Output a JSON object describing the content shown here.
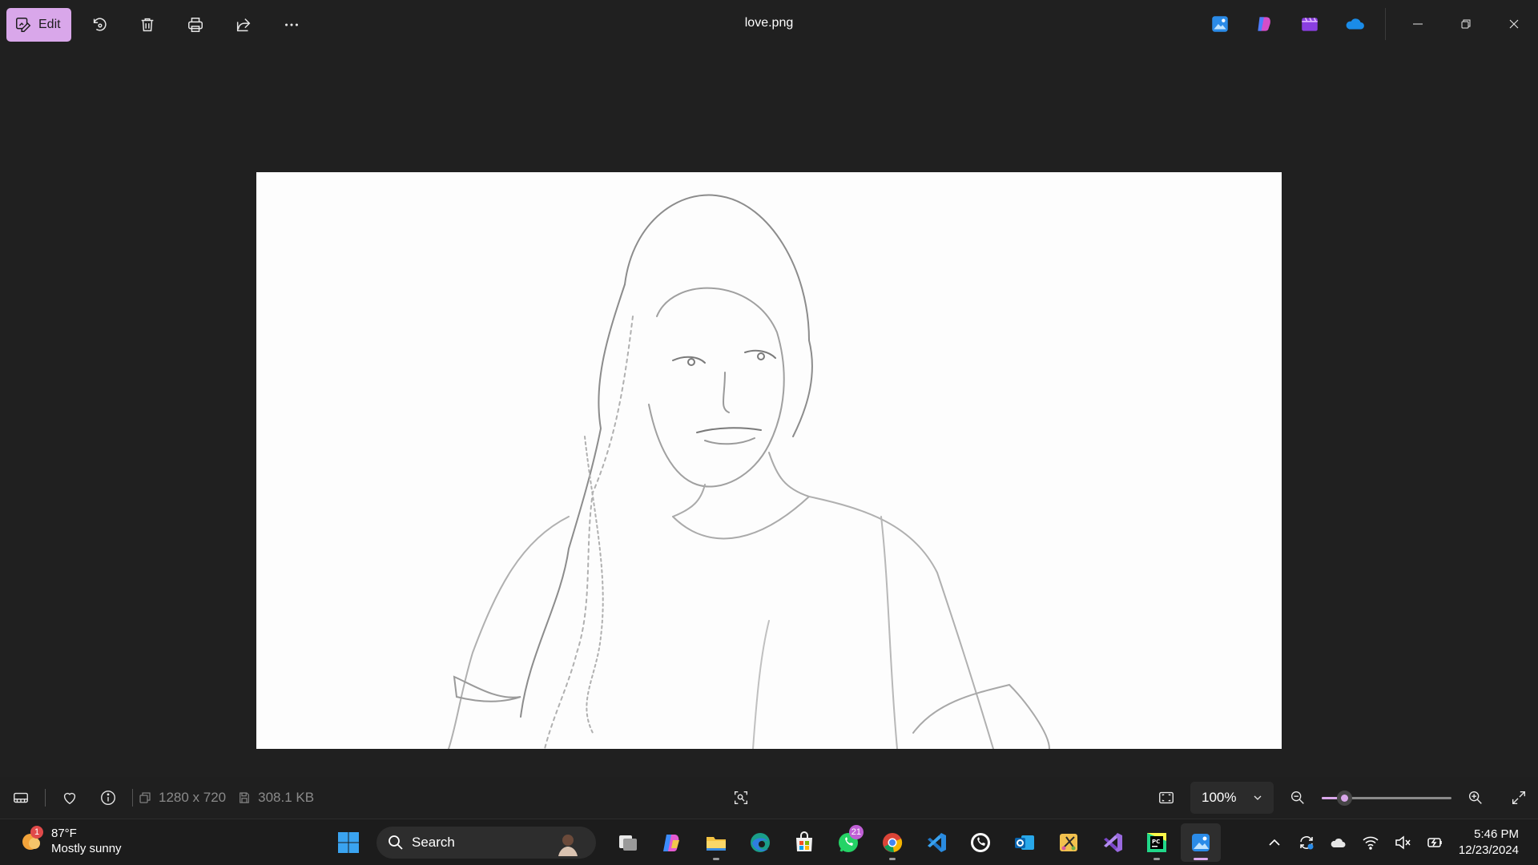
{
  "titlebar": {
    "edit_label": "Edit",
    "file_name": "love.png",
    "accent_color": "#d9a7ea",
    "toolbar_icons": [
      "rotate-icon",
      "delete-icon",
      "print-icon",
      "share-icon",
      "more-icon"
    ],
    "app_badges": [
      "photos-icon",
      "copilot-icon",
      "clipchamp-icon",
      "onedrive-icon"
    ],
    "window_controls": [
      "minimize-icon",
      "restore-icon",
      "close-icon"
    ]
  },
  "image": {
    "description_kind": "pencil-sketch photo"
  },
  "statusbar": {
    "dimensions": "1280 x 720",
    "file_size": "308.1 KB",
    "zoom_value": "100%",
    "zoom_fraction": 0.17
  },
  "taskbar": {
    "weather": {
      "temp": "87°F",
      "condition": "Mostly sunny",
      "badge": "1"
    },
    "search_label": "Search",
    "apps": [
      {
        "name": "task-view"
      },
      {
        "name": "copilot"
      },
      {
        "name": "file-explorer"
      },
      {
        "name": "edge"
      },
      {
        "name": "microsoft-store"
      },
      {
        "name": "whatsapp-business",
        "badge": "21"
      },
      {
        "name": "chrome"
      },
      {
        "name": "vscode"
      },
      {
        "name": "whatsapp"
      },
      {
        "name": "outlook"
      },
      {
        "name": "snipping"
      },
      {
        "name": "visual-studio"
      },
      {
        "name": "pycharm"
      },
      {
        "name": "photos"
      }
    ],
    "clock": {
      "time": "5:46 PM",
      "date": "12/23/2024"
    }
  }
}
